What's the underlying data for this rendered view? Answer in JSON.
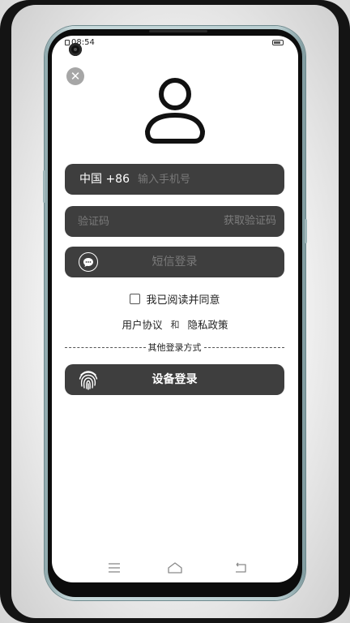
{
  "status_bar": {
    "time": "08:54"
  },
  "login": {
    "close_symbol": "✕",
    "phone_row": {
      "country_label": "中国 +86",
      "placeholder": "输入手机号"
    },
    "code_row": {
      "placeholder": "验证码",
      "get_code_label": "获取验证码"
    },
    "sms_button_label": "短信登录",
    "agreement_label": "我已阅读并同意",
    "user_agreement_link": "用户协议",
    "and_text": "和",
    "privacy_policy_link": "隐私政策",
    "other_methods_label": "其他登录方式",
    "device_login_label": "设备登录"
  },
  "icons": {
    "close": "close-icon",
    "avatar": "user-avatar-icon",
    "sms": "chat-bubble-icon",
    "fingerprint": "fingerprint-icon",
    "nav_menu": "menu-icon",
    "nav_home": "home-icon",
    "nav_back": "back-icon"
  },
  "colors": {
    "pill_bg": "#3e3e3e",
    "placeholder": "#7a7a7a",
    "text_white": "#ffffff",
    "close_bg": "#a6a6a6"
  }
}
